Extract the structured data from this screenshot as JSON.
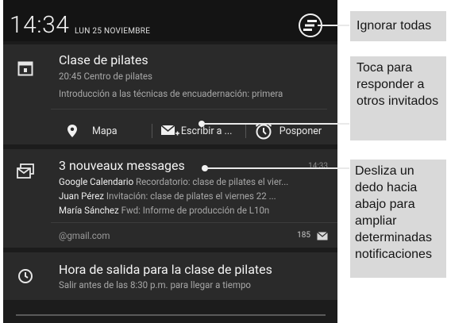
{
  "status_bar": {
    "time": "14:34",
    "date": "LUN 25 NOVIEMBRE",
    "clear_all_icon": "clear-all-icon"
  },
  "notifications": [
    {
      "icon": "calendar-icon",
      "title": "Clase de pilates",
      "subtitle": "20:45 Centro de pilates",
      "detail": "Introducción a las técnicas de encuadernación: primera",
      "actions": [
        {
          "icon": "location-pin-icon",
          "label": "Mapa"
        },
        {
          "icon": "email-plus-icon",
          "label": "Escribir a ..."
        },
        {
          "icon": "alarm-clock-icon",
          "label": "Posponer"
        }
      ]
    },
    {
      "icon": "gmail-stack-icon",
      "title": "3 nouveaux messages",
      "time": "14:33",
      "messages": [
        {
          "from": "Google Calendario",
          "snippet": "Recordatorio: clase de pilates el vier..."
        },
        {
          "from": "Juan Pérez",
          "snippet": "Invitación: clase de pilates el viernes 22 ..."
        },
        {
          "from": "María Sánchez",
          "snippet": "Fwd: Informe de producción de L10n"
        }
      ],
      "account": "@gmail.com",
      "count": "185",
      "count_icon": "mail-icon"
    },
    {
      "icon": "clock-icon",
      "title": "Hora de salida para la clase de pilates",
      "subtitle": "Salir antes de las 8:30 p.m. para llegar a tiempo"
    }
  ],
  "callouts": {
    "clear_all": "Ignorar todas",
    "reply": "Toca para responder a otros invitados",
    "expand": "Desliza un dedo hacia abajo para ampliar determinadas notificaciones"
  },
  "colors": {
    "shade_bg": "#1c1c1c",
    "card_bg": "#2a2a2a",
    "callout_bg": "#d9d9d9"
  }
}
